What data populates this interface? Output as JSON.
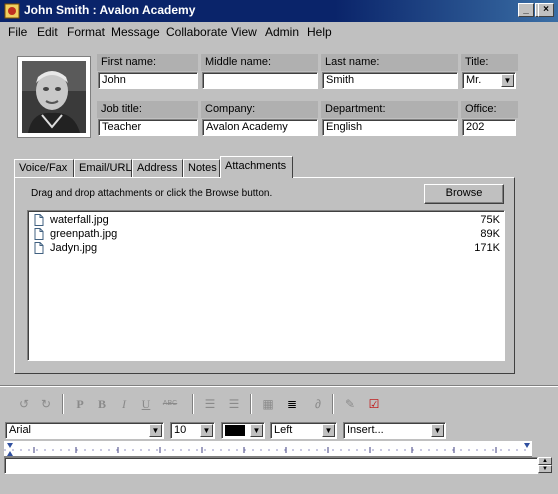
{
  "window": {
    "title": "John Smith : Avalon Academy"
  },
  "menu": [
    "File",
    "Edit",
    "Format",
    "Message",
    "Collaborate",
    "View",
    "Admin",
    "Help"
  ],
  "contact": {
    "first_name": {
      "label": "First name:",
      "value": "John"
    },
    "middle_name": {
      "label": "Middle name:",
      "value": ""
    },
    "last_name": {
      "label": "Last name:",
      "value": "Smith"
    },
    "title": {
      "label": "Title:",
      "value": "Mr."
    },
    "job_title": {
      "label": "Job title:",
      "value": "Teacher"
    },
    "company": {
      "label": "Company:",
      "value": "Avalon Academy"
    },
    "department": {
      "label": "Department:",
      "value": "English"
    },
    "office": {
      "label": "Office:",
      "value": "202"
    }
  },
  "tabs": [
    "Voice/Fax",
    "Email/URL",
    "Address",
    "Notes",
    "Attachments"
  ],
  "active_tab": "Attachments",
  "attachments": {
    "instruction": "Drag and drop attachments or click the Browse button.",
    "browse_label": "Browse",
    "files": [
      {
        "name": "waterfall.jpg",
        "size": "75K"
      },
      {
        "name": "greenpath.jpg",
        "size": "89K"
      },
      {
        "name": "Jadyn.jpg",
        "size": "171K"
      }
    ]
  },
  "toolbar": {
    "bold": "B",
    "italic": "I",
    "underline": "U",
    "strike": "ABC",
    "plain": "P"
  },
  "format": {
    "font": "Arial",
    "size": "10",
    "color": "#000000",
    "align": "Left",
    "insert": "Insert..."
  },
  "colors": {
    "titlebar": "#0a246a",
    "face": "#c0c0c0",
    "label_bg": "#b0b0b0"
  }
}
